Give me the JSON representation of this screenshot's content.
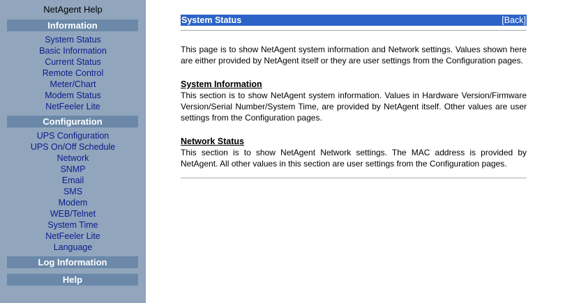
{
  "sidebar": {
    "title": "NetAgent Help",
    "information": {
      "heading": "Information",
      "items": [
        "System Status",
        "Basic Information",
        "Current Status",
        "Remote Control",
        "Meter/Chart",
        "Modem Status",
        "NetFeeler Lite"
      ]
    },
    "configuration": {
      "heading": "Configuration",
      "items": [
        "UPS Configuration",
        "UPS On/Off Schedule",
        "Network",
        "SNMP",
        "Email",
        "SMS",
        "Modem",
        "WEB/Telnet",
        "System Time",
        "NetFeeler Lite",
        "Language"
      ]
    },
    "log_information": "Log Information",
    "help": "Help"
  },
  "main": {
    "title": "System Status",
    "back_label": "[Back]",
    "intro": "This page is to show NetAgent system information and Network settings. Values shown here are either provided by NetAgent itself or they are user settings from the Configuration pages.",
    "sections": [
      {
        "heading": "System Information",
        "body": "This section is to show NetAgent system information. Values in Hardware Version/Firmware Version/Serial Number/System Time, are provided by NetAgent itself. Other values are user settings from the Configuration pages."
      },
      {
        "heading": "Network Status",
        "body": "This section is to show NetAgent Network settings. The MAC address is provided by NetAgent. All other values in this section are user settings from the Configuration pages."
      }
    ]
  }
}
